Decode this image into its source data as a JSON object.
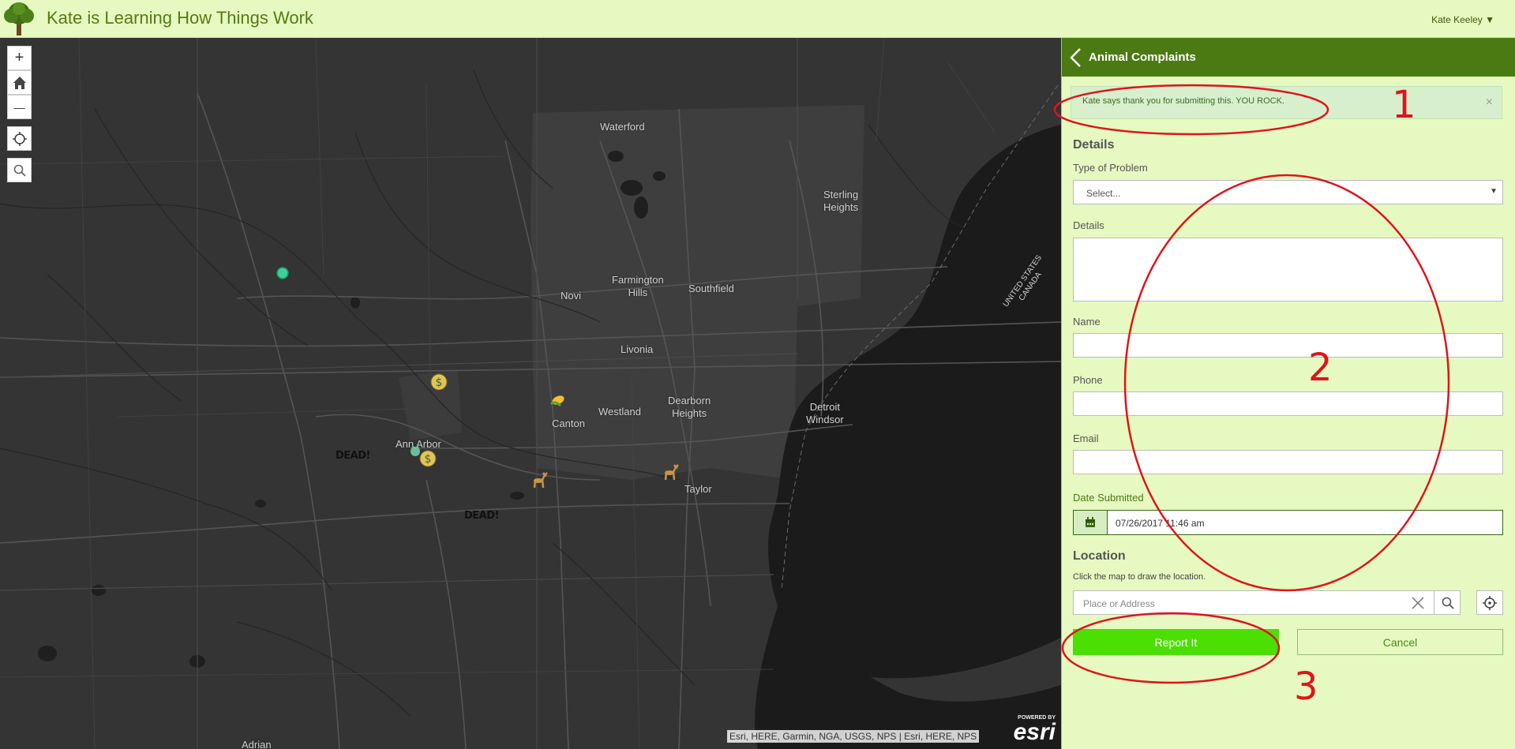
{
  "header": {
    "title": "Kate is Learning How Things Work",
    "user_menu": "Kate Keeley  ▼"
  },
  "map": {
    "labels": [
      {
        "key": "waterford",
        "text": "Waterford"
      },
      {
        "key": "sterling",
        "text": "Sterling\nHeights"
      },
      {
        "key": "farmington",
        "text": "Farmington\nHills"
      },
      {
        "key": "southfield",
        "text": "Southfield"
      },
      {
        "key": "novi",
        "text": "Novi"
      },
      {
        "key": "livonia",
        "text": "Livonia"
      },
      {
        "key": "westland",
        "text": "Westland"
      },
      {
        "key": "canton",
        "text": "Canton"
      },
      {
        "key": "dearborn",
        "text": "Dearborn\nHeights"
      },
      {
        "key": "detroit",
        "text": "Detroit\nWindsor"
      },
      {
        "key": "annarbor",
        "text": "Ann Arbor"
      },
      {
        "key": "taylor",
        "text": "Taylor"
      },
      {
        "key": "adrian",
        "text": "Adrian"
      },
      {
        "key": "border",
        "text": "UNITED STATES\nCANADA"
      }
    ],
    "dead_labels": [
      "DEAD!",
      "DEAD!"
    ],
    "attribution": "Esri, HERE, Garmin, NGA, USGS, NPS | Esri, HERE, NPS",
    "esri_powered": "POWERED BY",
    "esri_brand": "esri",
    "controls": {
      "zoom_in": "+",
      "zoom_out": "—"
    }
  },
  "panel": {
    "title": "Animal Complaints",
    "alert": "Kate says thank you for submitting this. YOU ROCK.",
    "alert_close": "×",
    "details_section": "Details",
    "type_label": "Type of Problem",
    "type_value": "Select...",
    "details_label": "Details",
    "name_label": "Name",
    "phone_label": "Phone",
    "email_label": "Email",
    "date_label": "Date Submitted",
    "date_value": "07/26/2017 11:46 am",
    "location_section": "Location",
    "location_hint": "Click the map to draw the location.",
    "address_placeholder": "Place or Address",
    "report_button": "Report It",
    "cancel_button": "Cancel"
  },
  "annotations": [
    "1",
    "2",
    "3"
  ],
  "colors": {
    "accent": "#4b7a12",
    "panel_bg": "#e6f9c0",
    "report": "#4cdf04",
    "annotation": "#e0141a"
  }
}
